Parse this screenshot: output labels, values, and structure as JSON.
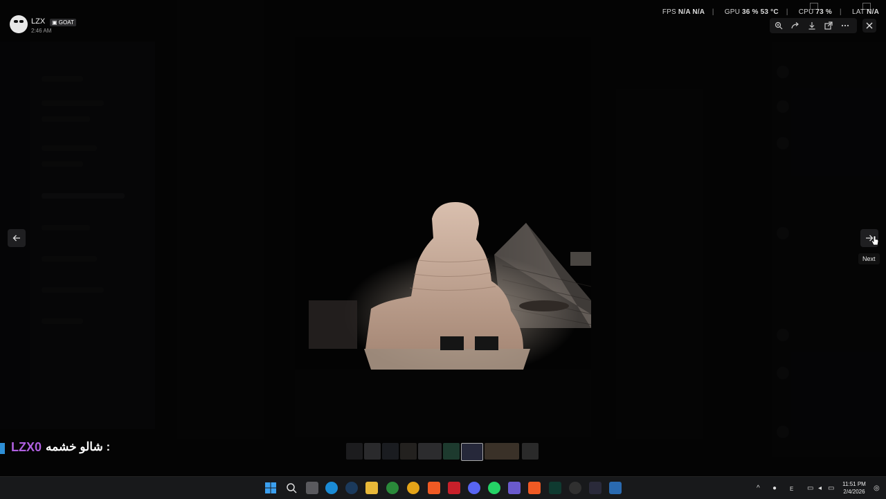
{
  "viewer": {
    "user_name": "LZX",
    "user_badge": "GOAT",
    "timestamp": "2:46 AM",
    "next_tooltip": "Next",
    "toolbar_icons": [
      "zoom-in-icon",
      "forward-icon",
      "download-icon",
      "open-external-icon",
      "more-icon"
    ]
  },
  "hud": {
    "fps_label": "FPS",
    "fps_value_1": "N/A",
    "fps_value_2": "N/A",
    "gpu_label": "GPU",
    "gpu_value_1": "36 %",
    "gpu_value_2": "53 °C",
    "cpu_label": "CPU",
    "cpu_value": "73 %",
    "lat_label": "LAT",
    "lat_value": "N/A"
  },
  "stream_overlay": {
    "name": "LZX0",
    "separator": ":",
    "message": "شالو خشمه"
  },
  "taskbar": {
    "time": "11:51 PM",
    "date": "2/4/2026",
    "lang": "E",
    "apps": [
      "windows-start-icon",
      "search-icon",
      "task-view-icon",
      "edge-icon",
      "steam-icon",
      "file-explorer-icon",
      "xbox-icon",
      "chrome-icon",
      "brave-icon",
      "app-icon",
      "discord-icon",
      "whatsapp-icon",
      "app-grid-icon",
      "brave-icon",
      "terminal-icon",
      "obs-icon",
      "app-icon",
      "security-icon"
    ]
  },
  "colors": {
    "overlay_name": "#b060e0",
    "overlay_bar": "#2e8fd6",
    "taskbar_bg": "#18191b"
  }
}
